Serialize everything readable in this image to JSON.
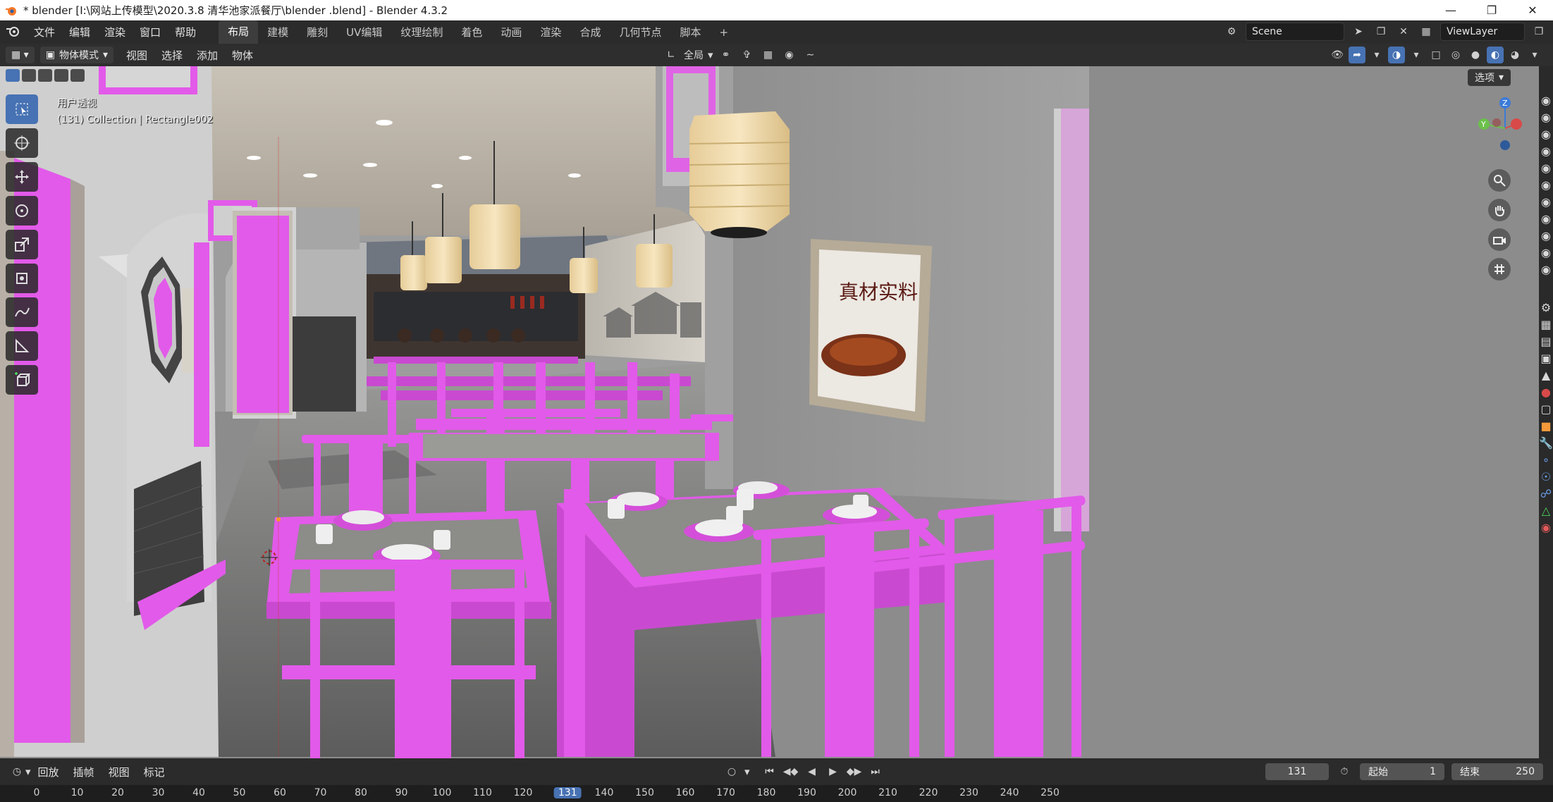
{
  "window": {
    "title": "* blender  [I:\\网站上传模型\\2020.3.8 清华池家派餐厅\\blender .blend] - Blender 4.3.2",
    "controls": [
      "minimize",
      "maximize",
      "close"
    ]
  },
  "topbar": {
    "menus": [
      "文件",
      "编辑",
      "渲染",
      "窗口",
      "帮助"
    ],
    "workspaces": [
      "布局",
      "建模",
      "雕刻",
      "UV编辑",
      "纹理绘制",
      "着色",
      "动画",
      "渲染",
      "合成",
      "几何节点",
      "脚本"
    ],
    "active_workspace": "布局",
    "add_tab": "+",
    "scene_label": "Scene",
    "viewlayer_label": "ViewLayer"
  },
  "viewport_header": {
    "mode": "物体模式",
    "menus": [
      "视图",
      "选择",
      "添加",
      "物体"
    ],
    "transform_orientation": "全局"
  },
  "viewport": {
    "view_name": "用户透视",
    "collection_info": "(131) Collection | Rectangle002",
    "options_label": "选项",
    "gizmo": {
      "z": "Z",
      "y": "Y"
    },
    "accent": "#4772b3",
    "magenta": "#e25ae9"
  },
  "tools": [
    "select-box",
    "cursor",
    "move",
    "rotate",
    "scale",
    "transform",
    "annotate",
    "measure",
    "add-cube"
  ],
  "timeline": {
    "menus": [
      "回放",
      "插帧",
      "视图",
      "标记"
    ],
    "current_frame": "131",
    "start_label": "起始",
    "start_value": "1",
    "end_label": "结束",
    "end_value": "250",
    "ruler": [
      "0",
      "10",
      "20",
      "30",
      "40",
      "50",
      "60",
      "70",
      "80",
      "90",
      "100",
      "110",
      "120",
      "131",
      "140",
      "150",
      "160",
      "170",
      "180",
      "190",
      "200",
      "210",
      "220",
      "230",
      "240",
      "250"
    ]
  }
}
